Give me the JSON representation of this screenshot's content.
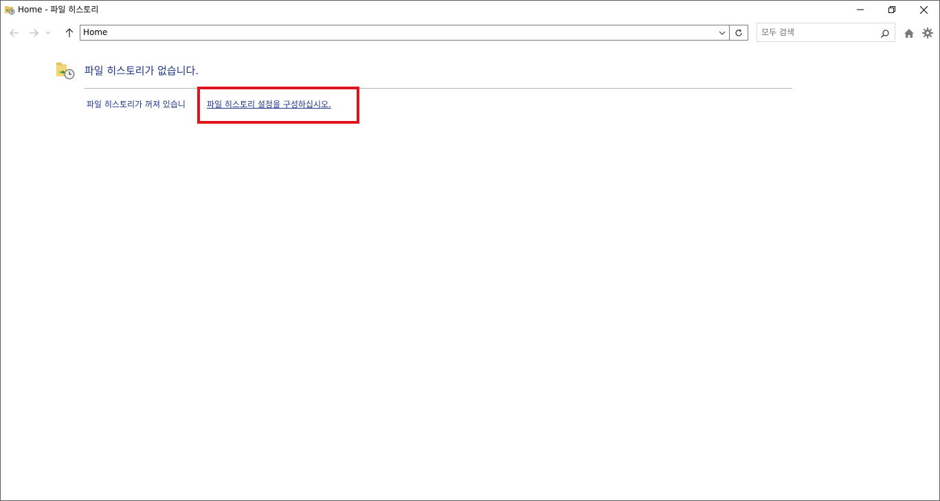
{
  "window": {
    "title": "Home - 파일 히스토리",
    "controls": {
      "minimize": "minimize-icon",
      "restore": "restore-icon",
      "close": "close-icon"
    }
  },
  "nav": {
    "back_icon": "arrow-left-icon",
    "forward_icon": "arrow-right-icon",
    "recent_icon": "chevron-down-icon",
    "up_icon": "arrow-up-icon",
    "address_value": "Home",
    "refresh_icon": "refresh-icon",
    "search_placeholder": "모두 검색",
    "home_icon": "home-icon",
    "settings_icon": "gear-icon"
  },
  "content": {
    "heading": "파일 히스토리가 없습니다.",
    "status_text": "파일 히스토리가 꺼져 있습니",
    "config_link": "파일 히스토리 설정을 구성하십시오.",
    "highlight_color": "#e0141a",
    "text_color": "#1e3287"
  }
}
